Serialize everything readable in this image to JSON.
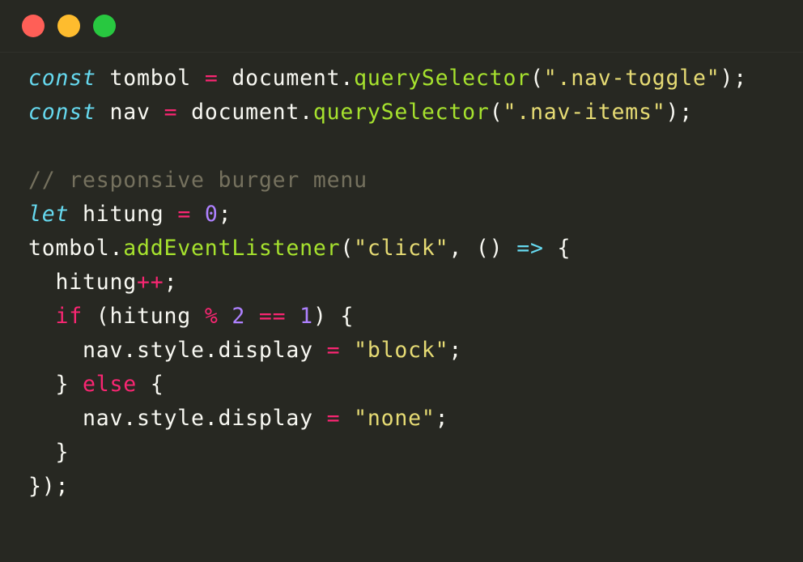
{
  "window": {
    "controls": {
      "close_color": "#ff5f57",
      "minimize_color": "#febc2e",
      "maximize_color": "#28c840"
    }
  },
  "editor": {
    "background": "#272822",
    "language": "javascript",
    "lines": [
      [
        {
          "t": "const",
          "c": "kw-it"
        },
        {
          "t": " tombol ",
          "c": "pl"
        },
        {
          "t": "=",
          "c": "op"
        },
        {
          "t": " document.",
          "c": "pl"
        },
        {
          "t": "querySelector",
          "c": "fn"
        },
        {
          "t": "(",
          "c": "pl"
        },
        {
          "t": "\".nav-toggle\"",
          "c": "str"
        },
        {
          "t": ");",
          "c": "pl"
        }
      ],
      [
        {
          "t": "const",
          "c": "kw-it"
        },
        {
          "t": " nav ",
          "c": "pl"
        },
        {
          "t": "=",
          "c": "op"
        },
        {
          "t": " document.",
          "c": "pl"
        },
        {
          "t": "querySelector",
          "c": "fn"
        },
        {
          "t": "(",
          "c": "pl"
        },
        {
          "t": "\".nav-items\"",
          "c": "str"
        },
        {
          "t": ");",
          "c": "pl"
        }
      ],
      [],
      [
        {
          "t": "// responsive burger menu",
          "c": "com"
        }
      ],
      [
        {
          "t": "let",
          "c": "kw-it"
        },
        {
          "t": " hitung ",
          "c": "pl"
        },
        {
          "t": "=",
          "c": "op"
        },
        {
          "t": " ",
          "c": "pl"
        },
        {
          "t": "0",
          "c": "num"
        },
        {
          "t": ";",
          "c": "pl"
        }
      ],
      [
        {
          "t": "tombol.",
          "c": "pl"
        },
        {
          "t": "addEventListener",
          "c": "fn"
        },
        {
          "t": "(",
          "c": "pl"
        },
        {
          "t": "\"click\"",
          "c": "str"
        },
        {
          "t": ", () ",
          "c": "pl"
        },
        {
          "t": "=>",
          "c": "arrow"
        },
        {
          "t": " {",
          "c": "pl"
        }
      ],
      [
        {
          "t": "  hitung",
          "c": "pl"
        },
        {
          "t": "++",
          "c": "op"
        },
        {
          "t": ";",
          "c": "pl"
        }
      ],
      [
        {
          "t": "  ",
          "c": "pl"
        },
        {
          "t": "if",
          "c": "kw"
        },
        {
          "t": " (hitung ",
          "c": "pl"
        },
        {
          "t": "%",
          "c": "op"
        },
        {
          "t": " ",
          "c": "pl"
        },
        {
          "t": "2",
          "c": "num"
        },
        {
          "t": " ",
          "c": "pl"
        },
        {
          "t": "==",
          "c": "op"
        },
        {
          "t": " ",
          "c": "pl"
        },
        {
          "t": "1",
          "c": "num"
        },
        {
          "t": ") {",
          "c": "pl"
        }
      ],
      [
        {
          "t": "    nav.style.display ",
          "c": "pl"
        },
        {
          "t": "=",
          "c": "op"
        },
        {
          "t": " ",
          "c": "pl"
        },
        {
          "t": "\"block\"",
          "c": "str"
        },
        {
          "t": ";",
          "c": "pl"
        }
      ],
      [
        {
          "t": "  } ",
          "c": "pl"
        },
        {
          "t": "else",
          "c": "kw"
        },
        {
          "t": " {",
          "c": "pl"
        }
      ],
      [
        {
          "t": "    nav.style.display ",
          "c": "pl"
        },
        {
          "t": "=",
          "c": "op"
        },
        {
          "t": " ",
          "c": "pl"
        },
        {
          "t": "\"none\"",
          "c": "str"
        },
        {
          "t": ";",
          "c": "pl"
        }
      ],
      [
        {
          "t": "  }",
          "c": "pl"
        }
      ],
      [
        {
          "t": "});",
          "c": "pl"
        }
      ]
    ]
  }
}
